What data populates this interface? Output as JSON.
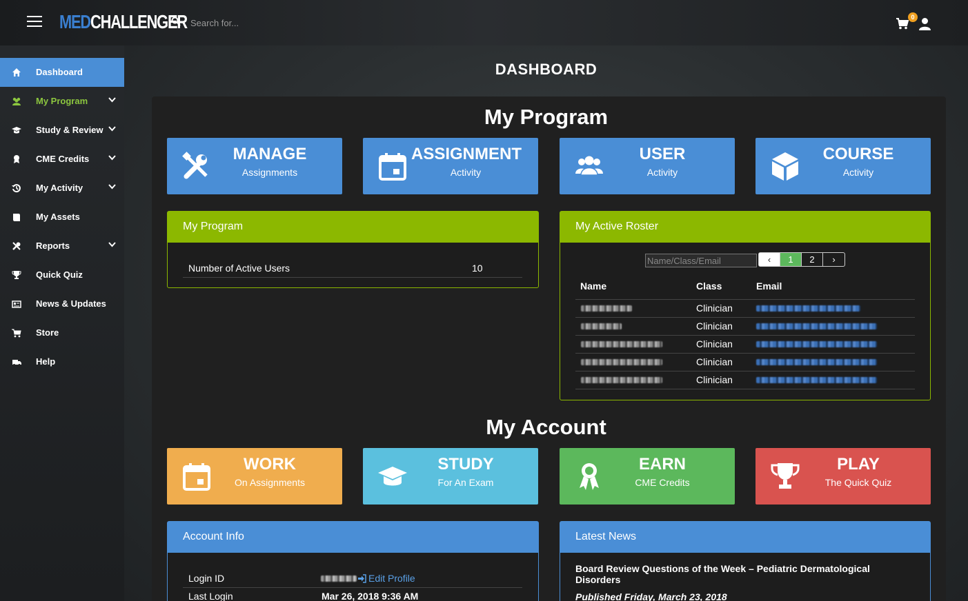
{
  "header": {
    "logo_med": "MED",
    "logo_challenger": "CHALLENGER",
    "search_placeholder": "Search for...",
    "cart_count": "0"
  },
  "sidebar": {
    "items": [
      {
        "label": "Dashboard",
        "icon": "home-icon"
      },
      {
        "label": "My Program",
        "icon": "users-icon"
      },
      {
        "label": "Study & Review",
        "icon": "graduation-cap-icon"
      },
      {
        "label": "CME Credits",
        "icon": "award-icon"
      },
      {
        "label": "My Activity",
        "icon": "history-icon"
      },
      {
        "label": "My Assets",
        "icon": "book-icon"
      },
      {
        "label": "Reports",
        "icon": "tools-icon"
      },
      {
        "label": "Quick Quiz",
        "icon": "trophy-icon"
      },
      {
        "label": "News & Updates",
        "icon": "newspaper-icon"
      },
      {
        "label": "Store",
        "icon": "cart-icon"
      },
      {
        "label": "Help",
        "icon": "ambulance-icon"
      }
    ]
  },
  "page": {
    "title": "DASHBOARD"
  },
  "my_program": {
    "section_title": "My Program",
    "tiles": [
      {
        "title": "MANAGE",
        "subtitle": "Assignments",
        "icon": "tools-icon"
      },
      {
        "title": "ASSIGNMENT",
        "subtitle": "Activity",
        "icon": "calendar-icon"
      },
      {
        "title": "USER",
        "subtitle": "Activity",
        "icon": "users-icon"
      },
      {
        "title": "COURSE",
        "subtitle": "Activity",
        "icon": "cube-icon"
      }
    ],
    "program_card": {
      "heading": "My Program",
      "row_label": "Number of Active Users",
      "row_value": "10"
    },
    "roster_card": {
      "heading": "My Active Roster",
      "search_placeholder": "Name/Class/Email",
      "pager": [
        "‹",
        "1",
        "2",
        "›"
      ],
      "columns": [
        "Name",
        "Class",
        "Email"
      ],
      "rows": [
        {
          "class": "Clinician"
        },
        {
          "class": "Clinician"
        },
        {
          "class": "Clinician"
        },
        {
          "class": "Clinician"
        },
        {
          "class": "Clinician"
        }
      ]
    }
  },
  "my_account": {
    "section_title": "My Account",
    "tiles": [
      {
        "title": "WORK",
        "subtitle": "On Assignments",
        "icon": "calendar-icon"
      },
      {
        "title": "STUDY",
        "subtitle": "For An Exam",
        "icon": "graduation-cap-icon"
      },
      {
        "title": "EARN",
        "subtitle": "CME Credits",
        "icon": "award-icon"
      },
      {
        "title": "PLAY",
        "subtitle": "The Quick Quiz",
        "icon": "trophy-icon"
      }
    ],
    "account_card": {
      "heading": "Account Info",
      "login_label": "Login ID",
      "edit_profile": "Edit Profile",
      "last_login_label": "Last Login",
      "last_login_value": "Mar 26, 2018 9:36 AM"
    },
    "news_card": {
      "heading": "Latest News",
      "news_title": "Board Review Questions of the Week – Pediatric Dermatological Disorders",
      "news_date": "Published Friday, March 23, 2018"
    }
  },
  "colors": {
    "accent_blue": "#4a8ed6",
    "accent_green": "#8cb800",
    "orange": "#f0ad4e",
    "cyan": "#5bc0de",
    "green": "#5cb85c",
    "red": "#d9534f"
  }
}
